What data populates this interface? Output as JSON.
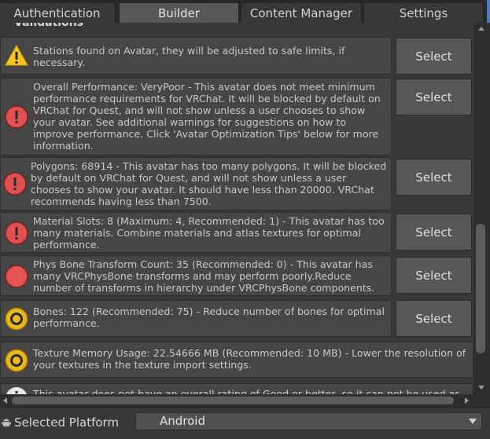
{
  "tabs": [
    {
      "label": "Authentication",
      "active": false
    },
    {
      "label": "Builder",
      "active": true
    },
    {
      "label": "Content Manager",
      "active": false
    },
    {
      "label": "Settings",
      "active": false
    }
  ],
  "section": {
    "title": "Validations"
  },
  "validations": [
    {
      "icon": "warning-icon",
      "text": "Stations found on Avatar, they will be adjusted to safe limits, if\nnecessary.",
      "button": "Select"
    },
    {
      "icon": "error-icon",
      "text": "Overall Performance: VeryPoor - This avatar does not meet minimum\nperformance requirements for VRChat. It will be blocked by default on\nVRChat for Quest, and will not show unless a user chooses to show\nyour avatar. See additional warnings for suggestions on how to\nimprove performance. Click 'Avatar Optimization Tips' below for more\ninformation.",
      "button": "Select"
    },
    {
      "icon": "error-icon",
      "text": "Polygons: 68914 - This avatar has too many polygons. It will be blocked\nby default on VRChat for Quest, and will not show unless a user\nchooses to show your avatar. It should have less than 20000. VRChat\nrecommends having less than 7500.",
      "button": "Select"
    },
    {
      "icon": "error-icon",
      "text": "Material Slots: 8 (Maximum: 4, Recommended: 1) - This avatar has too\nmany materials. Combine materials and atlas textures for optimal\nperformance.",
      "button": "Select"
    },
    {
      "icon": "error-dot-icon",
      "text": "Phys Bone Transform Count: 35 (Recommended: 0) - This avatar has\nmany VRCPhysBone transforms and may perform poorly.Reduce\nnumber of transforms in hierarchy under VRCPhysBone components.",
      "button": "Select"
    },
    {
      "icon": "medium-rating-icon",
      "text": "Bones: 122 (Recommended: 75) - Reduce number of bones for optimal\nperformance.",
      "button": "Select"
    },
    {
      "icon": "medium-rating-icon",
      "text": "Texture Memory Usage: 22.54666 MB (Recommended: 10 MB) - Lower the resolution of\nyour textures in the texture import settings."
    },
    {
      "icon": "info-icon",
      "text": "This avatar does not have an overall rating of Good or better, so it can not be used as"
    }
  ],
  "platform": {
    "label": "Selected Platform",
    "value": "Android"
  },
  "colors": {
    "error": "#e05050",
    "warning": "#f5c518",
    "medium": "#e8b720",
    "accent": "#4a78c8"
  }
}
